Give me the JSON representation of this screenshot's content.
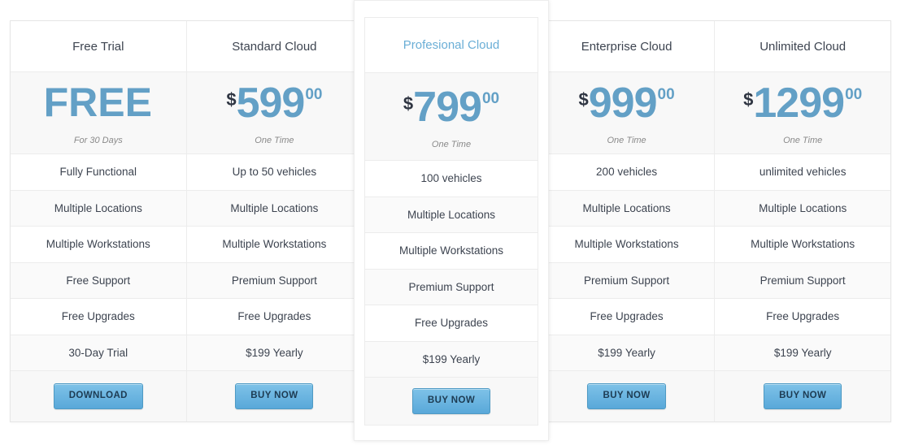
{
  "table": {
    "feature_row_count": 7,
    "accent_blue": "#63a0c6",
    "button_blue": "#59a8d9",
    "header_text_color": "#3d4450",
    "featured_header_color": "#6aaed6"
  },
  "plans": [
    {
      "name": "Free Trial",
      "featured": false,
      "currency": "",
      "amount": "FREE",
      "cents": "",
      "period": "For 30 Days",
      "features": [
        "Fully Functional",
        "Multiple Locations",
        "Multiple Workstations",
        "Free Support",
        "Free Upgrades",
        "30-Day Trial"
      ],
      "button_label": "DOWNLOAD"
    },
    {
      "name": "Standard Cloud",
      "featured": false,
      "currency": "$",
      "amount": "599",
      "cents": "00",
      "period": "One Time",
      "features": [
        "Up to 50 vehicles",
        "Multiple Locations",
        "Multiple Workstations",
        "Premium Support",
        "Free Upgrades",
        "$199 Yearly"
      ],
      "button_label": "BUY NOW"
    },
    {
      "name": "Profesional Cloud",
      "featured": true,
      "currency": "$",
      "amount": "799",
      "cents": "00",
      "period": "One Time",
      "features": [
        "100 vehicles",
        "Multiple Locations",
        "Multiple Workstations",
        "Premium Support",
        "Free Upgrades",
        "$199 Yearly"
      ],
      "button_label": "BUY NOW"
    },
    {
      "name": "Enterprise Cloud",
      "featured": false,
      "currency": "$",
      "amount": "999",
      "cents": "00",
      "period": "One Time",
      "features": [
        "200 vehicles",
        "Multiple Locations",
        "Multiple Workstations",
        "Premium Support",
        "Free Upgrades",
        "$199 Yearly"
      ],
      "button_label": "BUY NOW"
    },
    {
      "name": "Unlimited Cloud",
      "featured": false,
      "currency": "$",
      "amount": "1299",
      "cents": "00",
      "period": "One Time",
      "features": [
        "unlimited vehicles",
        "Multiple Locations",
        "Multiple Workstations",
        "Premium Support",
        "Free Upgrades",
        "$199 Yearly"
      ],
      "button_label": "BUY NOW"
    }
  ]
}
